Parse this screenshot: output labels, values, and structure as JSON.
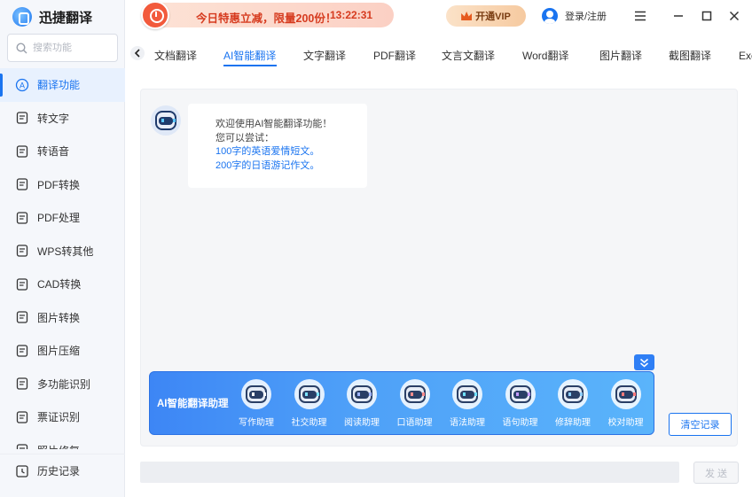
{
  "app": {
    "title": "迅捷翻译"
  },
  "search": {
    "placeholder": "搜索功能"
  },
  "sidebar": {
    "items": [
      {
        "label": "翻译功能",
        "icon": "translate-icon",
        "active": true
      },
      {
        "label": "转文字",
        "icon": "text-convert-icon"
      },
      {
        "label": "转语音",
        "icon": "voice-icon"
      },
      {
        "label": "PDF转换",
        "icon": "pdf-convert-icon"
      },
      {
        "label": "PDF处理",
        "icon": "pdf-process-icon"
      },
      {
        "label": "WPS转其他",
        "icon": "wps-icon"
      },
      {
        "label": "CAD转换",
        "icon": "cad-icon"
      },
      {
        "label": "图片转换",
        "icon": "image-convert-icon"
      },
      {
        "label": "图片压缩",
        "icon": "image-compress-icon"
      },
      {
        "label": "多功能识别",
        "icon": "recognize-icon"
      },
      {
        "label": "票证识别",
        "icon": "ticket-icon"
      },
      {
        "label": "照片修复",
        "icon": "photo-icon"
      }
    ],
    "history": {
      "label": "历史记录",
      "icon": "history-icon"
    }
  },
  "promo": {
    "text": "今日特惠立减，限量200份！",
    "countdown": "13:22:31"
  },
  "header": {
    "vip_label": "开通VIP",
    "login_label": "登录/注册"
  },
  "tabs": [
    {
      "label": "文档翻译"
    },
    {
      "label": "AI智能翻译",
      "active": true
    },
    {
      "label": "文字翻译"
    },
    {
      "label": "PDF翻译"
    },
    {
      "label": "文言文翻译"
    },
    {
      "label": "Word翻译"
    },
    {
      "label": "图片翻译"
    },
    {
      "label": "截图翻译"
    },
    {
      "label": "Excel翻译"
    }
  ],
  "chat": {
    "greeting": "欢迎使用AI智能翻译功能！",
    "hint": "您可以尝试：",
    "suggestions": [
      "100字的英语爱情短文。",
      "200字的日语游记作文。"
    ]
  },
  "assistants": {
    "title": "AI智能翻译助理",
    "items": [
      {
        "label": "写作助理",
        "eye": "#ffffff"
      },
      {
        "label": "社交助理",
        "eye": "#7de3ff"
      },
      {
        "label": "阅读助理",
        "eye": "#9fb4ff"
      },
      {
        "label": "口语助理",
        "eye": "#ff8d8d"
      },
      {
        "label": "语法助理",
        "eye": "#6fe0ff"
      },
      {
        "label": "语句助理",
        "eye": "#c49bff"
      },
      {
        "label": "修辞助理",
        "eye": "#8fd0ff"
      },
      {
        "label": "校对助理",
        "eye": "#ff7a7a"
      }
    ]
  },
  "actions": {
    "clear_label": "清空记录",
    "send_label": "发 送"
  },
  "colors": {
    "accent": "#1a74f0",
    "promo_text": "#d63b1f"
  }
}
